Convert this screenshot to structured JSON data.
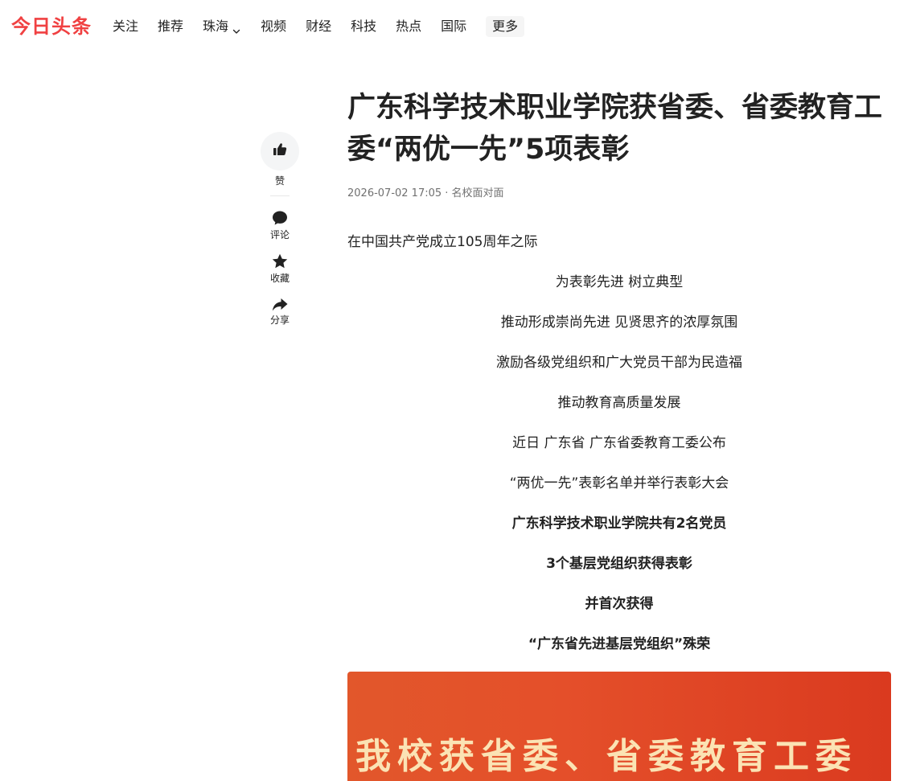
{
  "header": {
    "logo": "今日头条",
    "nav": [
      "关注",
      "推荐",
      "珠海",
      "视频",
      "财经",
      "科技",
      "热点",
      "国际"
    ],
    "more": "更多",
    "brand_color": "#f04142"
  },
  "sidebar": {
    "like_label": "赞",
    "comment_label": "评论",
    "collect_label": "收藏",
    "share_label": "分享",
    "icons": [
      "thumbs-up-icon",
      "comment-icon",
      "star-icon",
      "share-icon"
    ]
  },
  "article": {
    "title": "广东科学技术职业学院获省委、省委教育工委“两优一先”5项表彰",
    "meta": "2026-07-02 17:05 · 名校面对面",
    "lead": "在中国共产党成立105周年之际",
    "lines": [
      "为表彰先进 树立典型",
      "推动形成崇尚先进 见贤思齐的浓厚氛围",
      "激励各级党组织和广大党员干部为民造福",
      "推动教育高质量发展",
      "近日 广东省 广东省委教育工委公布",
      "“两优一先”表彰名单并举行表彰大会"
    ],
    "bold_lines": [
      "广东科学技术职业学院共有2名党员",
      "3个基层党组织获得表彰",
      "并首次获得",
      "“广东省先进基层党组织”殊荣"
    ],
    "banner_text": "我校获省委、省委教育工委"
  }
}
